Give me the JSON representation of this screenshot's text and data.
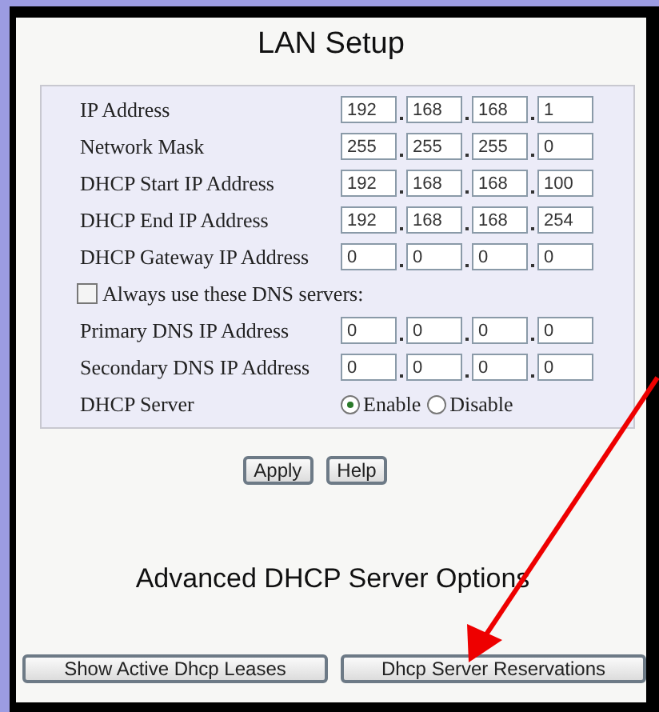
{
  "title": "LAN Setup",
  "rows": [
    {
      "kind": "ip",
      "label": "IP Address",
      "octets": [
        "192",
        "168",
        "168",
        "1"
      ]
    },
    {
      "kind": "ip",
      "label": "Network Mask",
      "octets": [
        "255",
        "255",
        "255",
        "0"
      ]
    },
    {
      "kind": "ip",
      "label": "DHCP Start IP Address",
      "octets": [
        "192",
        "168",
        "168",
        "100"
      ]
    },
    {
      "kind": "ip",
      "label": "DHCP End IP Address",
      "octets": [
        "192",
        "168",
        "168",
        "254"
      ]
    },
    {
      "kind": "ip",
      "label": "DHCP Gateway IP Address",
      "octets": [
        "0",
        "0",
        "0",
        "0"
      ]
    },
    {
      "kind": "checkbox",
      "label": "Always use these DNS servers:",
      "checked": false
    },
    {
      "kind": "ip",
      "label": "Primary DNS IP Address",
      "octets": [
        "0",
        "0",
        "0",
        "0"
      ]
    },
    {
      "kind": "ip",
      "label": "Secondary DNS IP Address",
      "octets": [
        "0",
        "0",
        "0",
        "0"
      ]
    },
    {
      "kind": "radio",
      "label": "DHCP Server",
      "options": [
        {
          "label": "Enable",
          "selected": true
        },
        {
          "label": "Disable",
          "selected": false
        }
      ]
    }
  ],
  "buttons": [
    "Apply",
    "Help"
  ],
  "advanced": {
    "title": "Advanced DHCP Server Options",
    "buttons": [
      "Show Active Dhcp Leases",
      "Dhcp Server Reservations"
    ]
  }
}
